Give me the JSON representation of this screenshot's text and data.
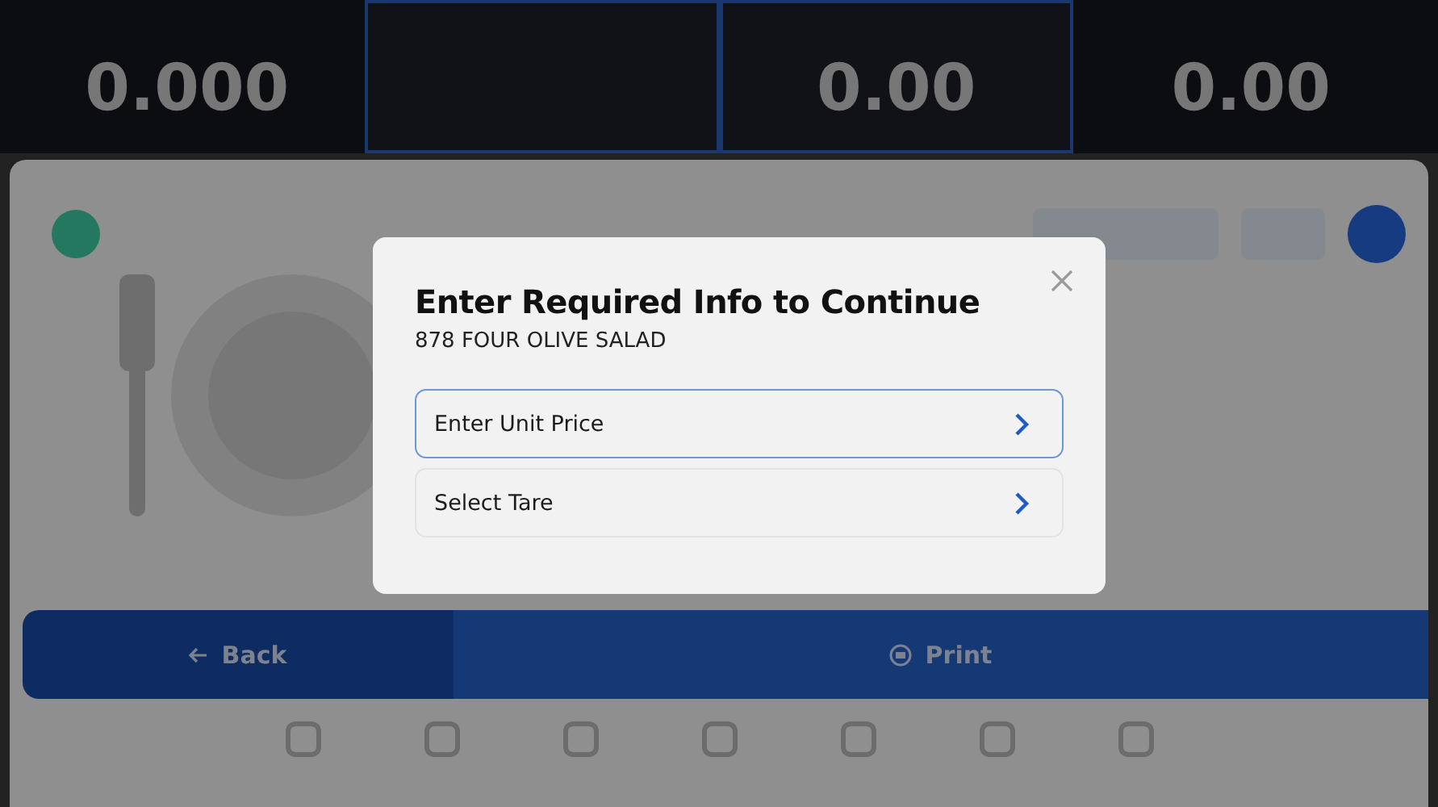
{
  "readouts": [
    {
      "value": "0.000",
      "selected": false
    },
    {
      "selected": true
    },
    {
      "value": "0.00",
      "selected": true
    },
    {
      "value": "0.00",
      "selected": false
    }
  ],
  "actions": [
    {
      "label": "Back",
      "kind": "back"
    },
    {
      "label": "Print",
      "kind": "print"
    }
  ],
  "dialog": {
    "title": "Enter Required Info to Continue",
    "subtitle": "878 FOUR OLIVE SALAD",
    "options": [
      {
        "label": "Enter Unit Price",
        "selected": true
      },
      {
        "label": "Select Tare",
        "selected": false
      }
    ]
  }
}
